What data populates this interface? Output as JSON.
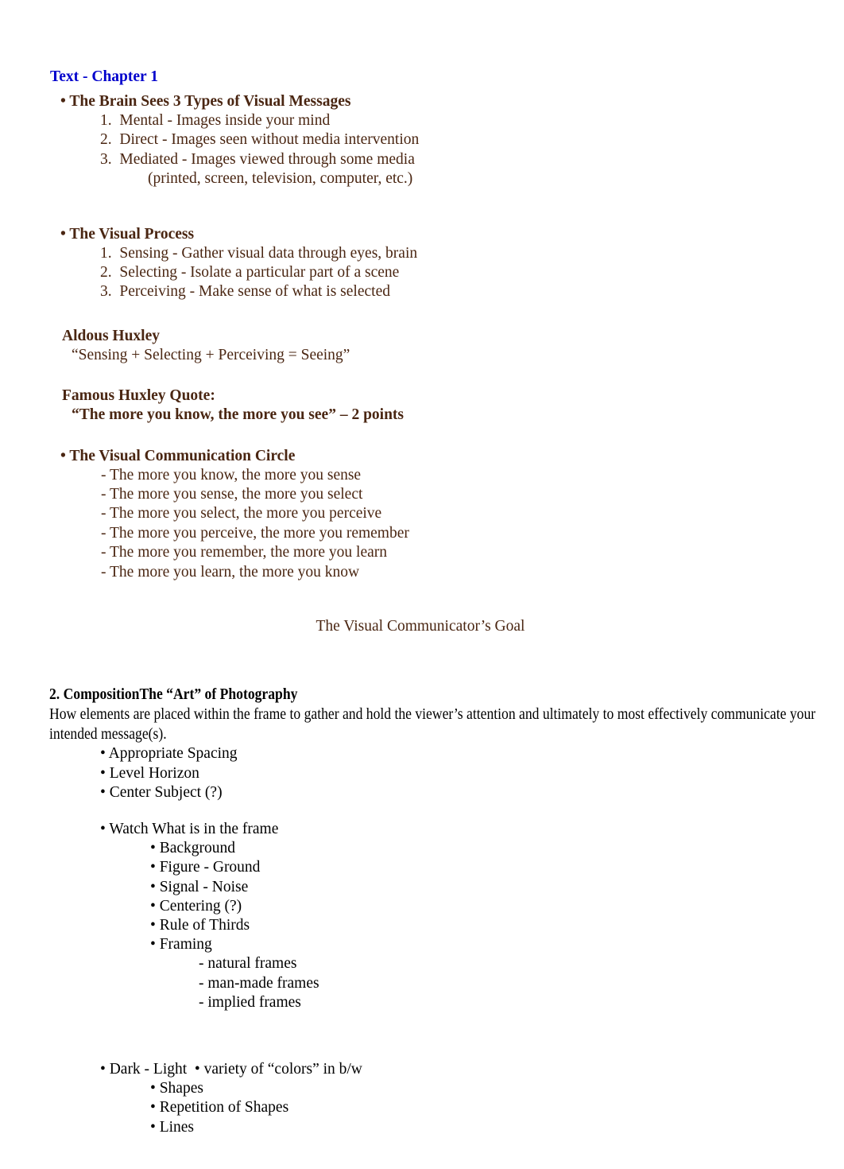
{
  "document": {
    "chapter_title": "Text - Chapter 1",
    "colors": {
      "title_blue": "#0000cc",
      "body_brown": "#4a2612",
      "body_black": "#000000",
      "page_background": "#ffffff"
    }
  },
  "section_brain": {
    "heading": "• The Brain Sees 3 Types of Visual Messages",
    "items": [
      "1.  Mental - Images inside your mind",
      "2.  Direct - Images seen without media intervention",
      "3.  Mediated - Images viewed through some media"
    ],
    "continuation": "(printed, screen, television, computer, etc.)"
  },
  "section_visual_process": {
    "heading": "• The Visual Process",
    "items": [
      "1.  Sensing - Gather visual data through eyes, brain",
      "2.  Selecting - Isolate a particular part of a scene",
      "3.  Perceiving - Make sense of what is selected"
    ]
  },
  "section_huxley": {
    "heading": "Aldous Huxley",
    "quote": "“Sensing + Selecting + Perceiving = Seeing”"
  },
  "section_famous_quote": {
    "heading": "Famous Huxley Quote",
    "heading_colon": ":",
    "quote": "“The more you know, the more you see” – 2 points"
  },
  "section_circle": {
    "heading": "• The Visual Communication Circle",
    "items": [
      "- The more you know, the more you sense",
      "- The more you sense, the more you select",
      "- The more you select, the more you perceive",
      "- The more you perceive, the more you remember",
      "- The more you remember, the more you learn",
      "- The more you learn, the more you know"
    ]
  },
  "goal_line": "The Visual Communicator’s Goal",
  "section_composition": {
    "heading": "2. CompositionThe “Art” of Photography",
    "body": "How elements are placed within the frame to gather and hold the viewer’s attention and ultimately to most effectively communicate your intended message(s).",
    "first_bullets": [
      "• Appropriate Spacing",
      "• Level Horizon",
      "• Center Subject (?)"
    ],
    "watch_heading": "• Watch What is in the frame",
    "watch_items": [
      "• Background",
      "• Figure - Ground",
      "• Signal - Noise",
      "• Centering (?)",
      "• Rule of Thirds",
      "• Framing"
    ],
    "framing_types": [
      "- natural frames",
      "- man-made frames",
      "- implied frames"
    ],
    "dark_light_line": "• Dark - Light  • variety of “colors” in b/w",
    "final_items": [
      "• Shapes",
      "• Repetition of Shapes",
      "• Lines"
    ]
  }
}
